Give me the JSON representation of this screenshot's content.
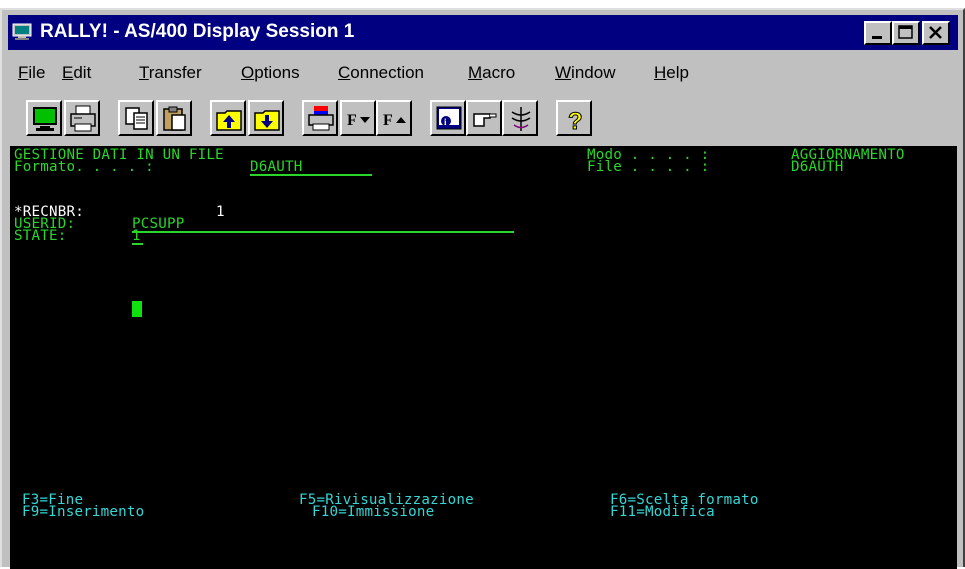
{
  "window": {
    "title": "RALLY! - AS/400 Display Session 1"
  },
  "menu": [
    "File",
    "Edit",
    "Transfer",
    "Options",
    "Connection",
    "Macro",
    "Window",
    "Help"
  ],
  "menu_underline": [
    "F",
    "E",
    "T",
    "O",
    "C",
    "M",
    "W",
    "H"
  ],
  "toolbar_icons": [
    "display-icon",
    "printer-icon",
    "copy-icon",
    "paste-icon",
    "upload-icon",
    "download-icon",
    "print-screen-icon",
    "font-decrease-icon",
    "font-increase-icon",
    "info-icon",
    "hand-pointer-icon",
    "graph-icon",
    "help-icon"
  ],
  "terminal": {
    "title": "GESTIONE DATI IN UN FILE",
    "formato_label": "Formato. . . . :",
    "formato_value": "D6AUTH",
    "modo_label": "Modo . . . . :",
    "modo_value": "AGGIORNAMENTO",
    "file_label": "File . . . . :",
    "file_value": "D6AUTH",
    "recnbr_label": "*RECNBR:",
    "recnbr_value": "1",
    "userid_label": "USERID:",
    "userid_value": "PCSUPP",
    "state_label": "STATE:",
    "state_value": "1",
    "fkeys": {
      "f3": "F3=Fine",
      "f9": "F9=Inserimento",
      "f5": "F5=Rivisualizzazione",
      "f10": "F10=Immissione",
      "f6": "F6=Scelta formato",
      "f11": "F11=Modifica"
    }
  }
}
